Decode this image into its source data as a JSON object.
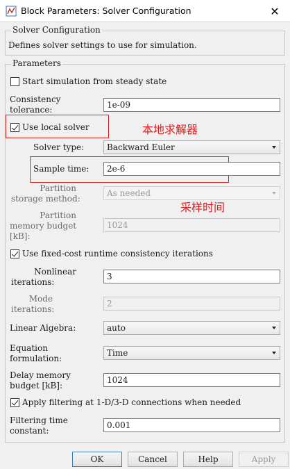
{
  "window": {
    "title": "Block Parameters: Solver Configuration",
    "close_symbol": "✕"
  },
  "description": {
    "group_label": "Solver Configuration",
    "text": "Defines solver settings to use for simulation."
  },
  "parameters": {
    "group_label": "Parameters",
    "start_steady_state": {
      "label": "Start simulation from steady state",
      "checked": false
    },
    "consistency_tolerance": {
      "label_line1": "Consistency",
      "label_line2": "tolerance:",
      "value": "1e-09"
    },
    "use_local_solver": {
      "label": "Use local solver",
      "checked": true
    },
    "solver_type": {
      "label": "Solver type:",
      "value": "Backward Euler"
    },
    "sample_time": {
      "label": "Sample time:",
      "value": "2e-6"
    },
    "partition_storage": {
      "label_line1": "Partition",
      "label_line2": "storage method:",
      "value": "As needed"
    },
    "partition_memory": {
      "label_line1": "Partition",
      "label_line2": "memory budget",
      "label_line3": "[kB]:",
      "value": "1024"
    },
    "fixed_cost": {
      "label": "Use fixed-cost runtime consistency iterations",
      "checked": true
    },
    "nonlinear_iterations": {
      "label_line1": "Nonlinear",
      "label_line2": "iterations:",
      "value": "3"
    },
    "mode_iterations": {
      "label_line1": "Mode",
      "label_line2": "iterations:",
      "value": "2"
    },
    "linear_algebra": {
      "label": "Linear Algebra:",
      "value": "auto"
    },
    "equation_formulation": {
      "label_line1": "Equation",
      "label_line2": "formulation:",
      "value": "Time"
    },
    "delay_memory": {
      "label_line1": "Delay memory",
      "label_line2": "budget [kB]:",
      "value": "1024"
    },
    "apply_filtering": {
      "label": "Apply filtering at 1-D/3-D connections when needed",
      "checked": true
    },
    "filtering_time": {
      "label_line1": "Filtering time",
      "label_line2": "constant:",
      "value": "0.001"
    }
  },
  "annotations": {
    "local_solver": "本地求解器",
    "sample_time": "采样时间",
    "color": "#e02020"
  },
  "buttons": {
    "ok": "OK",
    "cancel": "Cancel",
    "help": "Help",
    "apply": "Apply"
  }
}
